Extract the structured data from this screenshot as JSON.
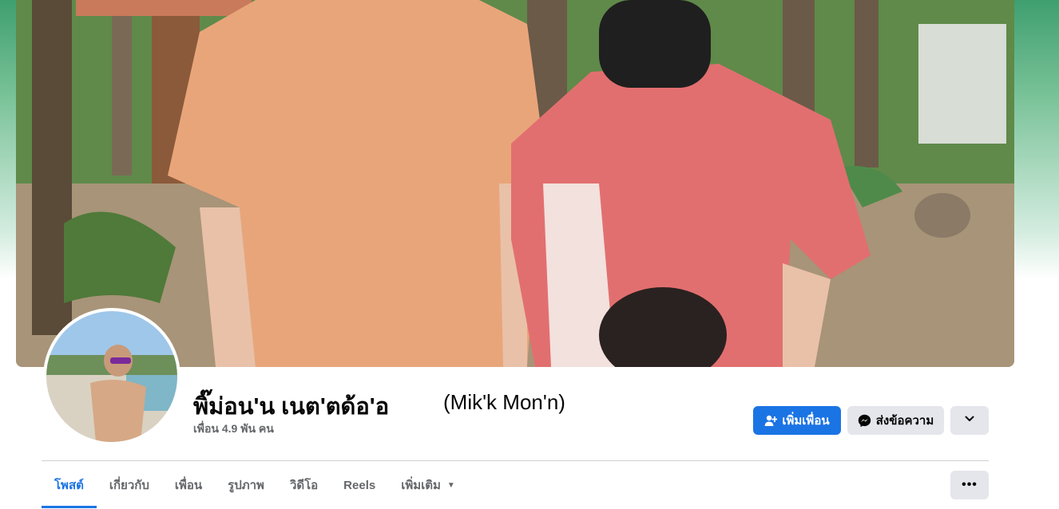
{
  "profile": {
    "name": "พิ๊ม่อน'น เนต'ตด้อ'อ",
    "alternate_name": "(Mik'k Mon'n)",
    "friends": "เพื่อน 4.9 พัน คน"
  },
  "actions": {
    "add_friend": "เพิ่มเพื่อน",
    "message": "ส่งข้อความ"
  },
  "tabs": [
    {
      "label": "โพสต์",
      "active": true
    },
    {
      "label": "เกี่ยวกับ",
      "active": false
    },
    {
      "label": "เพื่อน",
      "active": false
    },
    {
      "label": "รูปภาพ",
      "active": false
    },
    {
      "label": "วิดีโอ",
      "active": false
    },
    {
      "label": "Reels",
      "active": false
    },
    {
      "label": "เพิ่มเติม",
      "active": false
    }
  ],
  "more_dots": "•••",
  "colors": {
    "accent": "#1b74e4",
    "button_gray": "#e4e6eb",
    "text_secondary": "#65676b",
    "cover_gradient_top": "#3f9f6f"
  },
  "icons": {
    "add_friend": "person-plus-icon",
    "message": "messenger-icon",
    "more": "chevron-down-icon",
    "tab_more": "caret-down-icon",
    "overflow": "ellipsis-icon"
  }
}
